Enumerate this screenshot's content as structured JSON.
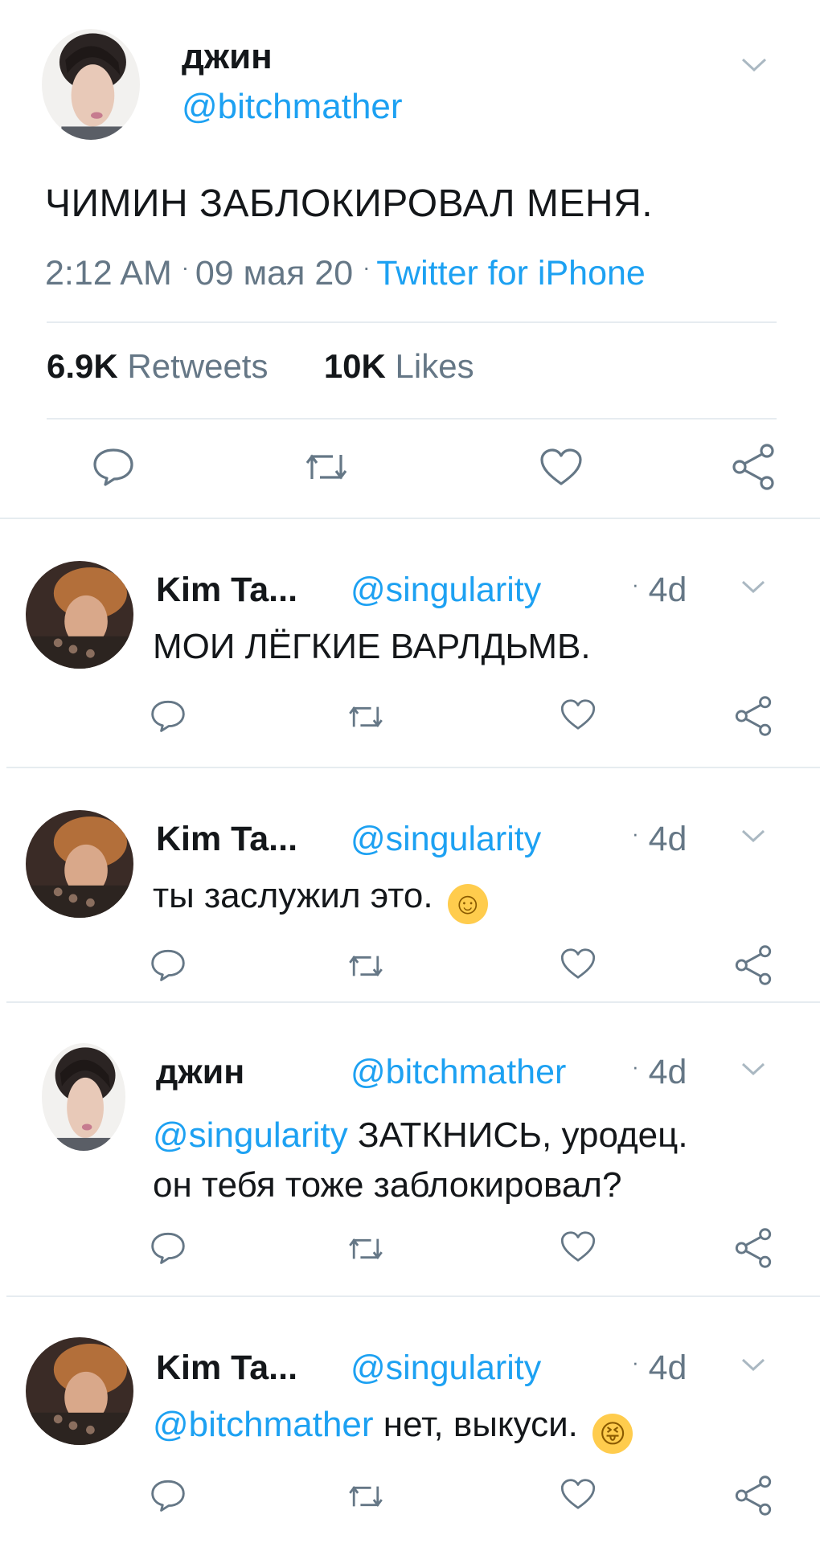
{
  "main_tweet": {
    "display_name": "джин",
    "handle": "@bitchmather",
    "text": "ЧИМИН ЗАБЛОКИРОВАЛ МЕНЯ.",
    "time": "2:12 AM",
    "date": "09 мая 20",
    "source": "Twitter for iPhone",
    "retweets_count": "6.9K",
    "retweets_label": "Retweets",
    "likes_count": "10K",
    "likes_label": "Likes"
  },
  "replies": [
    {
      "display_name": "Kim Ta...",
      "handle": "@singularity",
      "age": "4d",
      "mention": "",
      "text": "МОИ ЛЁГКИЕ ВАРЛДЬМВ.",
      "text_line2": "",
      "emoji": ""
    },
    {
      "display_name": "Kim Ta...",
      "handle": "@singularity",
      "age": "4d",
      "mention": "",
      "text": "ты заслужил это.",
      "text_line2": "",
      "emoji": "☺"
    },
    {
      "display_name": "джин",
      "handle": "@bitchmather",
      "age": "4d",
      "mention": "@singularity",
      "text": "ЗАТКНИСЬ, уродец.",
      "text_line2": "он тебя тоже заблокировал?",
      "emoji": ""
    },
    {
      "display_name": "Kim Ta...",
      "handle": "@singularity",
      "age": "4d",
      "mention": "@bitchmather",
      "text": "нет, выкуси.",
      "text_line2": "",
      "emoji": "😝"
    }
  ],
  "icons": [
    "reply-icon",
    "retweet-icon",
    "like-icon",
    "share-icon",
    "chevron-down-icon",
    "avatar"
  ],
  "colors": {
    "link_blue": "#1da1f2",
    "meta_grey": "#657786",
    "icon_grey": "#657786",
    "divider": "#e6ecf0"
  }
}
